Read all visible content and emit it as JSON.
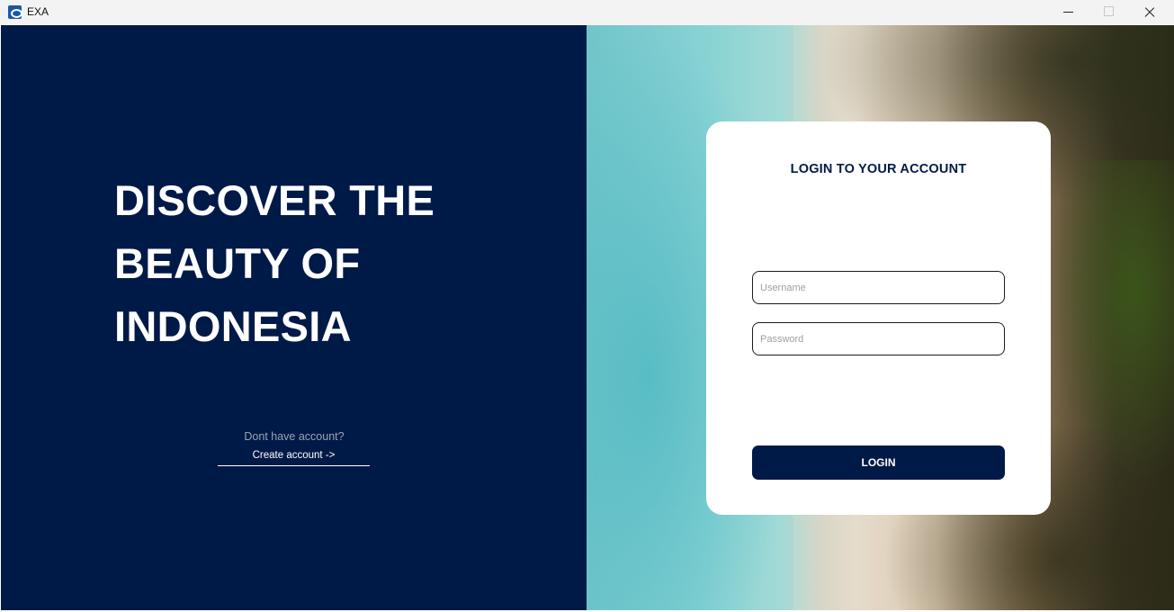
{
  "window": {
    "title": "EXA",
    "app_icon": "exa-logo-icon",
    "controls": [
      "minimize-icon",
      "maximize-icon",
      "close-icon"
    ]
  },
  "hero": {
    "line1": "DISCOVER THE",
    "line2": "BEAUTY OF",
    "line3": "INDONESIA",
    "no_account_text": "Dont have account?",
    "create_account_link": "Create account ->"
  },
  "login": {
    "title": "LOGIN TO YOUR ACCOUNT",
    "username_placeholder": "Username",
    "username_value": "",
    "password_placeholder": "Password",
    "password_value": "",
    "button_label": "LOGIN"
  },
  "colors": {
    "brand_navy": "#001a47",
    "card_background": "#ffffff"
  }
}
